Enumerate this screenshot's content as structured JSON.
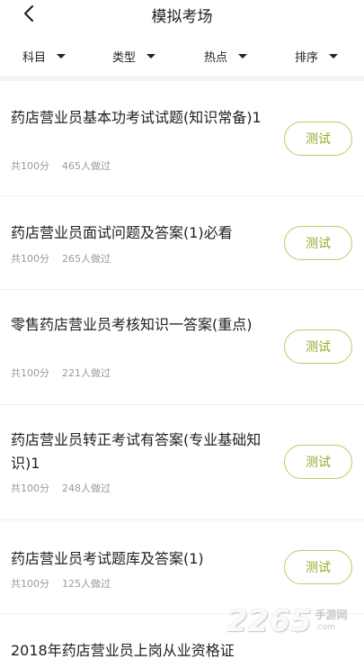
{
  "header": {
    "title": "模拟考场"
  },
  "filters": [
    {
      "label": "科目"
    },
    {
      "label": "类型"
    },
    {
      "label": "热点"
    },
    {
      "label": "排序"
    }
  ],
  "items": [
    {
      "title": "药店营业员基本功考试试题(知识常备)1",
      "score": "共100分",
      "count": "465人做过",
      "button": "测试"
    },
    {
      "title": "药店营业员面试问题及答案(1)必看",
      "score": "共100分",
      "count": "265人做过",
      "button": "测试"
    },
    {
      "title": "零售药店营业员考核知识一答案(重点)",
      "score": "共100分",
      "count": "221人做过",
      "button": "测试"
    },
    {
      "title": "药店营业员转正考试有答案(专业基础知识)1",
      "score": "共100分",
      "count": "248人做过",
      "button": "测试"
    },
    {
      "title": "药店营业员考试题库及答案(1)",
      "score": "共100分",
      "count": "125人做过",
      "button": "测试"
    },
    {
      "title": "2018年药店营业员上岗从业资格证",
      "score": "",
      "count": "",
      "button": ""
    }
  ],
  "watermark": {
    "number": "2265",
    "cn": "手游网",
    "com": ".com"
  },
  "colors": {
    "accent": "#8faf2a",
    "accent_border": "#b8cf5f",
    "meta": "#9a9a9a"
  }
}
